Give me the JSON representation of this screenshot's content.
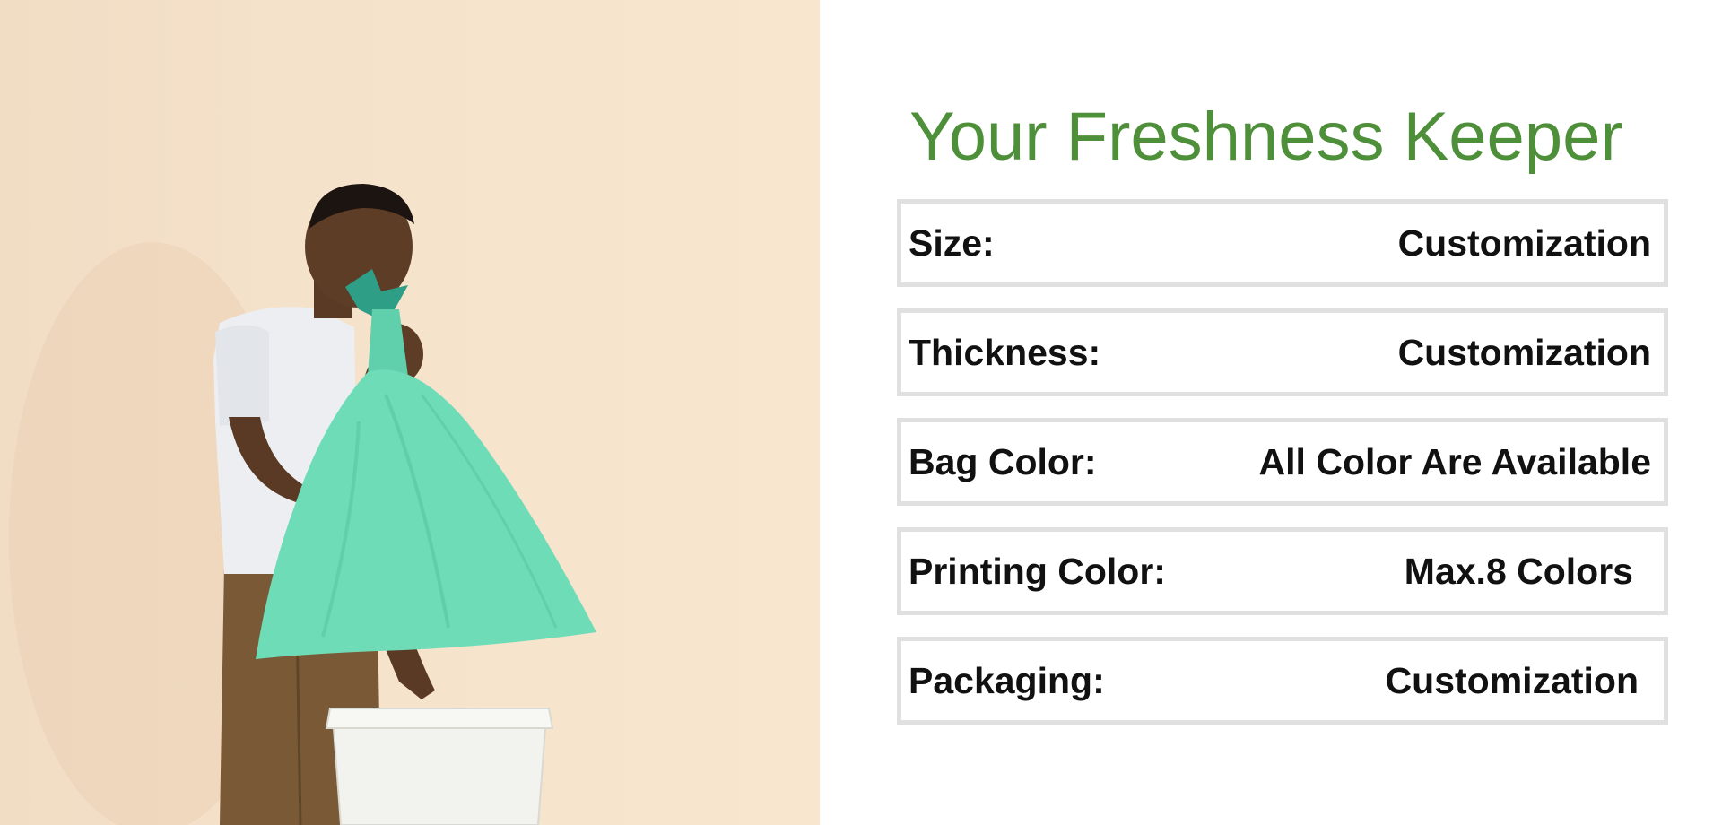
{
  "headline": "Your Freshness Keeper",
  "colors": {
    "headline": "#4e8f3a",
    "photo_background": "#f5e2ca",
    "row_border": "#e0e0e0",
    "text": "#111111",
    "bag": "#6fdcb8"
  },
  "photo": {
    "subject": "man-holding-trash-bag-icon"
  },
  "specs": [
    {
      "label": "Size:",
      "value": "Customization"
    },
    {
      "label": "Thickness:",
      "value": "Customization"
    },
    {
      "label": "Bag Color:",
      "value": "All Color Are Available"
    },
    {
      "label": "Printing Color:",
      "value": "Max.8 Colors"
    },
    {
      "label": "Packaging:",
      "value": "Customization"
    }
  ]
}
